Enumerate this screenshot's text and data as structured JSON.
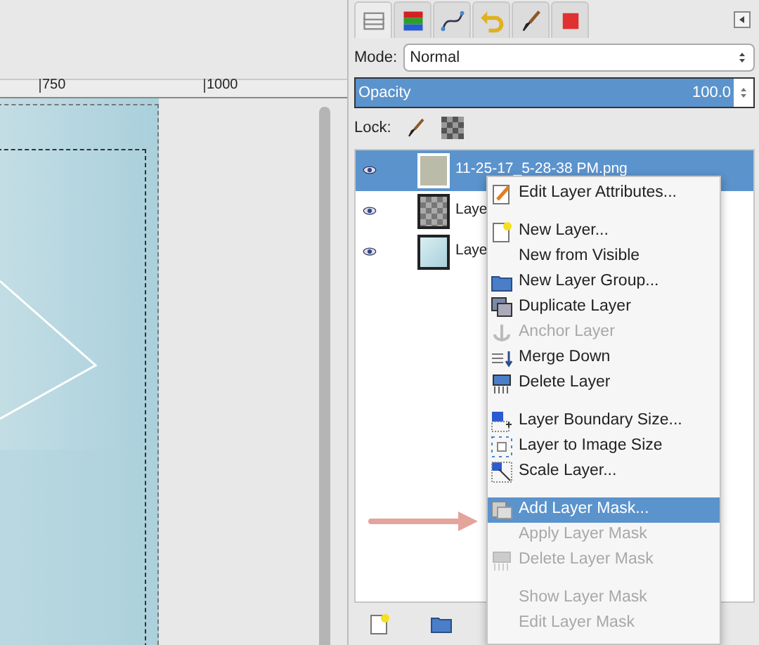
{
  "ruler": {
    "labels": [
      "750",
      "1000"
    ]
  },
  "dock": {
    "tabs": [
      {
        "selected": true
      },
      {
        "selected": false
      },
      {
        "selected": false
      },
      {
        "selected": false
      },
      {
        "selected": false
      },
      {
        "selected": false
      }
    ],
    "mode": {
      "label": "Mode:",
      "value": "Normal"
    },
    "opacity": {
      "label": "Opacity",
      "value": "100.0",
      "level": 1.0
    },
    "lock": {
      "label": "Lock:"
    },
    "layers": [
      {
        "name": "11-25-17_5-28-38 PM.png",
        "selected": true,
        "visible": true
      },
      {
        "name": "Laye",
        "selected": false,
        "visible": true
      },
      {
        "name": "Laye",
        "selected": false,
        "visible": true
      }
    ]
  },
  "context_menu": {
    "items": [
      {
        "kind": "item",
        "label": "Edit Layer Attributes...",
        "disabled": false,
        "selected": false
      },
      {
        "kind": "separator"
      },
      {
        "kind": "item",
        "label": "New Layer...",
        "disabled": false,
        "selected": false
      },
      {
        "kind": "item",
        "label": "New from Visible",
        "disabled": false,
        "selected": false
      },
      {
        "kind": "item",
        "label": "New Layer Group...",
        "disabled": false,
        "selected": false
      },
      {
        "kind": "item",
        "label": "Duplicate Layer",
        "disabled": false,
        "selected": false
      },
      {
        "kind": "item",
        "label": "Anchor Layer",
        "disabled": true,
        "selected": false
      },
      {
        "kind": "item",
        "label": "Merge Down",
        "disabled": false,
        "selected": false
      },
      {
        "kind": "item",
        "label": "Delete Layer",
        "disabled": false,
        "selected": false
      },
      {
        "kind": "separator"
      },
      {
        "kind": "item",
        "label": "Layer Boundary Size...",
        "disabled": false,
        "selected": false
      },
      {
        "kind": "item",
        "label": "Layer to Image Size",
        "disabled": false,
        "selected": false
      },
      {
        "kind": "item",
        "label": "Scale Layer...",
        "disabled": false,
        "selected": false
      },
      {
        "kind": "separator"
      },
      {
        "kind": "item",
        "label": "Add Layer Mask...",
        "disabled": false,
        "selected": true
      },
      {
        "kind": "item",
        "label": "Apply Layer Mask",
        "disabled": true,
        "selected": false
      },
      {
        "kind": "item",
        "label": "Delete Layer Mask",
        "disabled": true,
        "selected": false
      },
      {
        "kind": "separator"
      },
      {
        "kind": "item",
        "label": "Show Layer Mask",
        "disabled": true,
        "selected": false
      },
      {
        "kind": "item",
        "label": "Edit Layer Mask",
        "disabled": true,
        "selected": false
      }
    ]
  }
}
